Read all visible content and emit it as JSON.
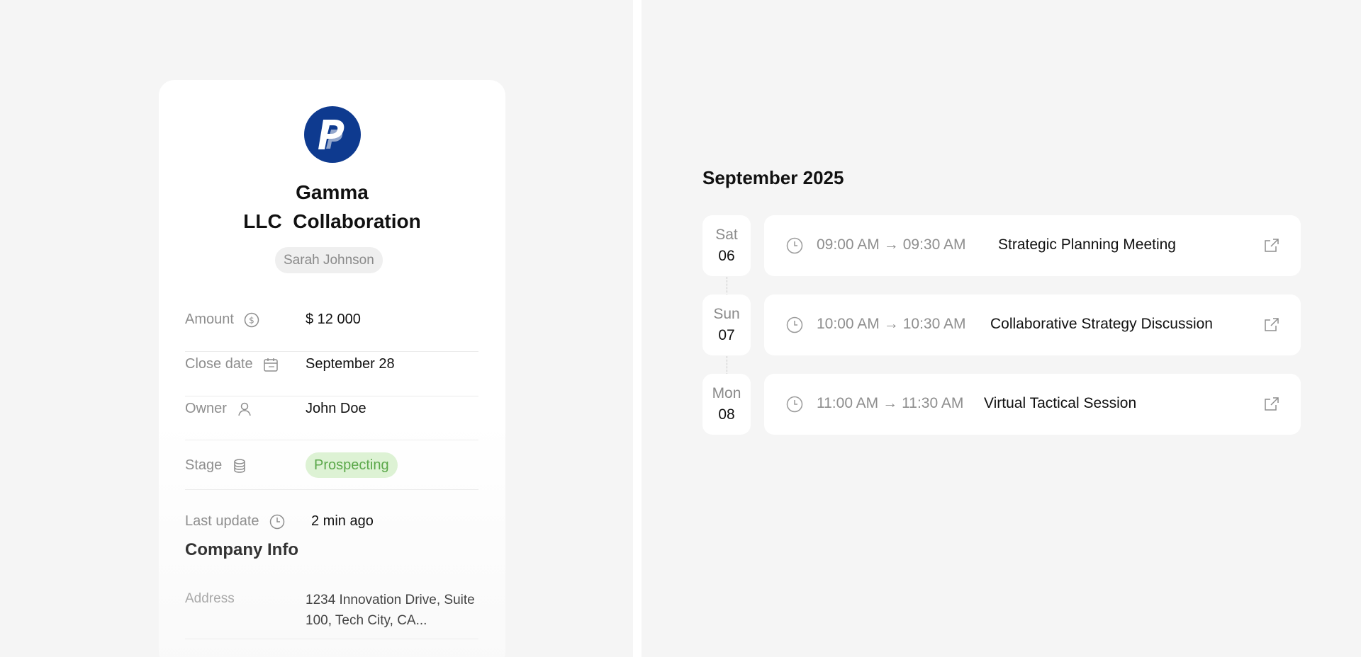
{
  "deal": {
    "logo_icon": "paypal-logo",
    "title_line1": "Gamma",
    "title_line2": "LLC  Collaboration",
    "contact": "Sarah Johnson",
    "properties": [
      {
        "label": "Amount",
        "icon": "dollar-icon",
        "value": "$ 12 000"
      },
      {
        "label": "Close date",
        "icon": "calendar-icon",
        "value": "September 28"
      },
      {
        "label": "Owner",
        "icon": "person-icon",
        "value": "John Doe"
      },
      {
        "label": "Stage",
        "icon": "stack-icon",
        "value": "Prospecting"
      },
      {
        "label": "Last update",
        "icon": "clock-icon",
        "value": "2 min ago"
      }
    ],
    "stage_color": "#5ba84a",
    "company_info_title": "Company Info",
    "address_label": "Address",
    "address_value": "1234 Innovation Drive, Suite 100, Tech City, CA..."
  },
  "calendar": {
    "month": "September 2025",
    "events": [
      {
        "dow": "Sat",
        "day": "06",
        "start": "09:00 AM",
        "end": "09:30 AM",
        "arrow": "→",
        "title": "Strategic Planning Meeting"
      },
      {
        "dow": "Sun",
        "day": "07",
        "start": "10:00 AM",
        "end": "10:30 AM",
        "arrow": "→",
        "title": "Collaborative Strategy Discussion"
      },
      {
        "dow": "Mon",
        "day": "08",
        "start": "11:00 AM",
        "end": "11:30 AM",
        "arrow": "→",
        "title": "Virtual Tactical Session"
      }
    ]
  }
}
